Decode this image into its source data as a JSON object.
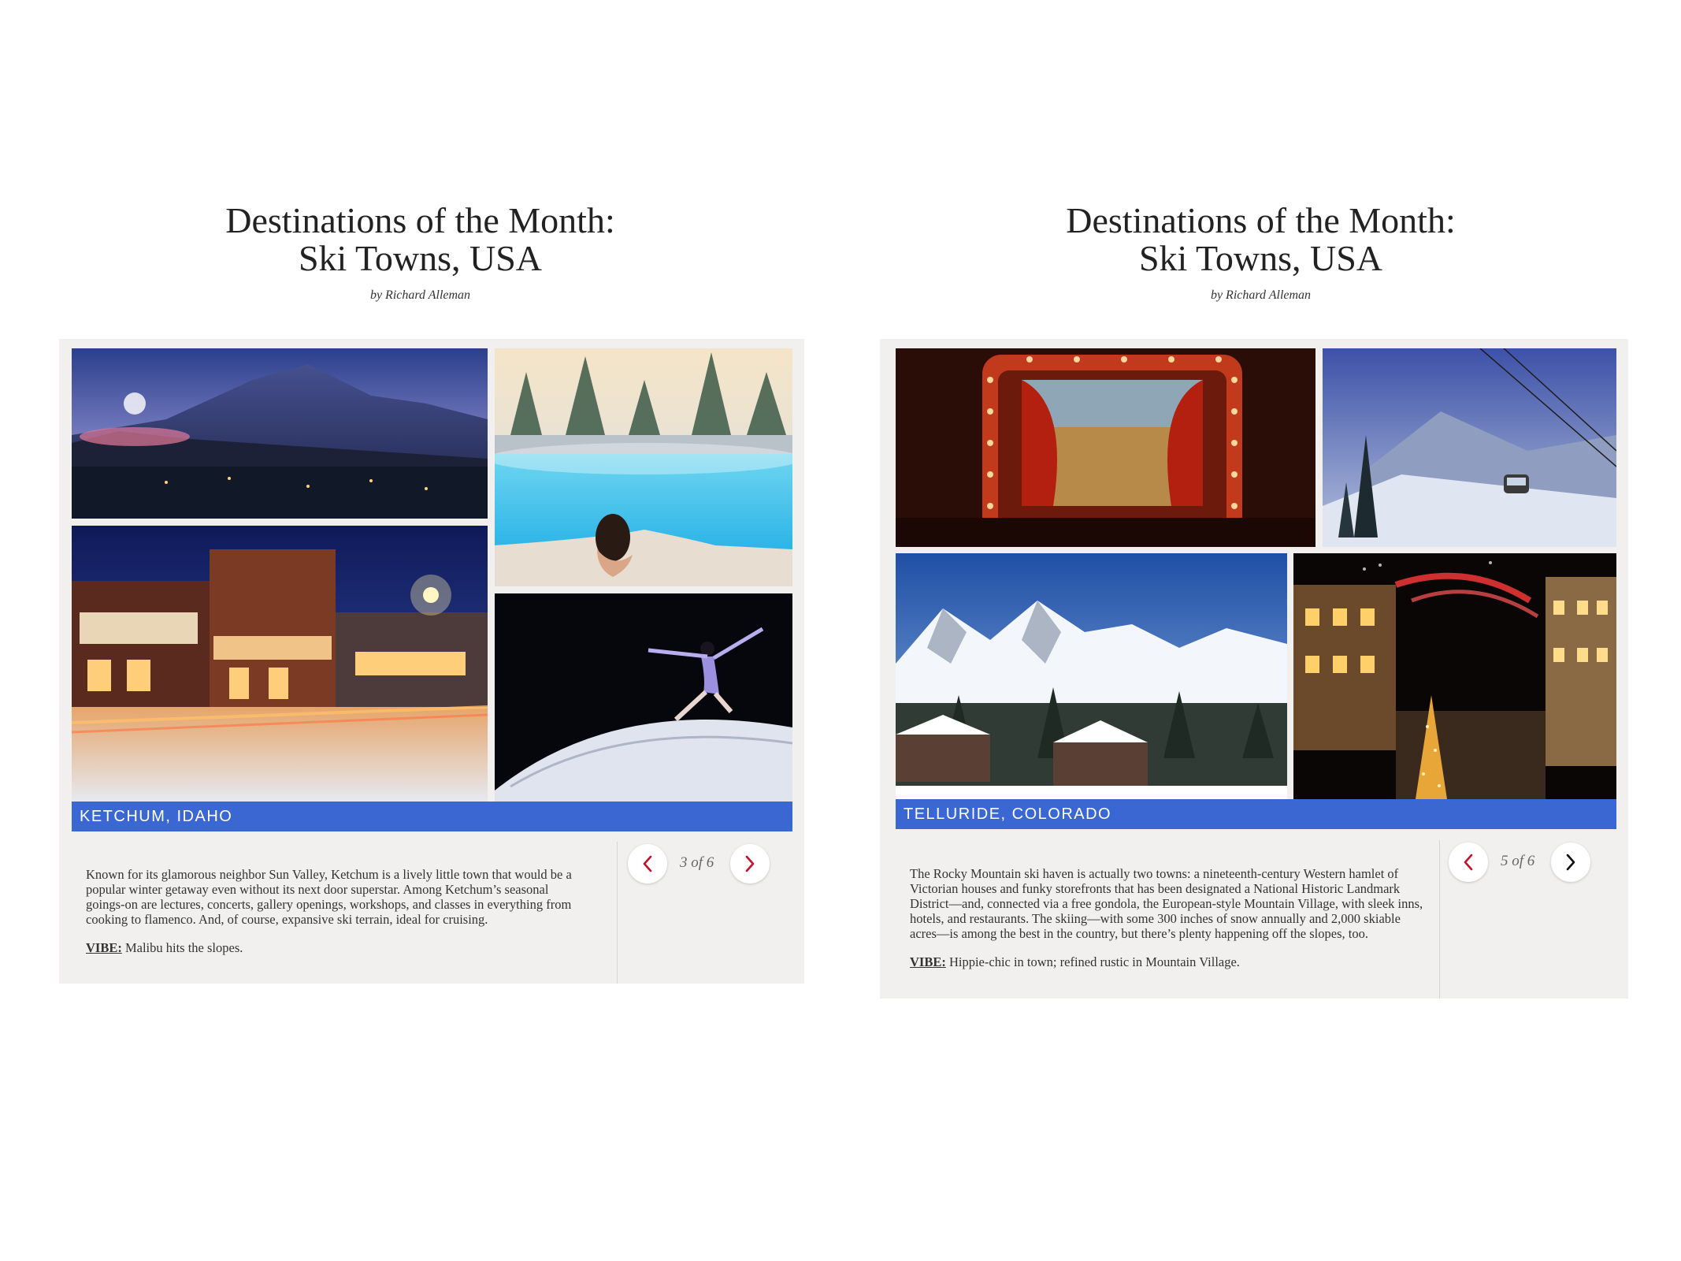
{
  "slides": [
    {
      "title_line1": "Destinations of the Month:",
      "title_line2": "Ski Towns, USA",
      "byline": "by Richard Alleman",
      "location": "KETCHUM, IDAHO",
      "description": "Known for its glamorous neighbor Sun Valley, Ketchum is a lively little town that would be a popular winter getaway even without its next door superstar. Among Ketchum’s seasonal goings-on are lectures, concerts, gallery openings, workshops, and classes in everything from cooking to flamenco. And, of course, expansive ski terrain, ideal for cruising.",
      "vibe_label": "VIBE:",
      "vibe_text": "Malibu hits the slopes.",
      "counter": "3 of 6",
      "prev_icon": "chevron-left-icon",
      "next_icon": "chevron-right-icon",
      "prev_color": "#c8102e",
      "next_color": "#c8102e"
    },
    {
      "title_line1": "Destinations of the Month:",
      "title_line2": "Ski Towns, USA",
      "byline": "by Richard Alleman",
      "location": "TELLURIDE, COLORADO",
      "description": "The Rocky Mountain ski haven is actually two towns: a nineteenth-century Western hamlet of Victorian houses and funky storefronts that has been designated a National Historic Landmark District—and, connected via a free gondola, the European-style Mountain Village, with sleek inns, hotels, and restaurants. The skiing—with some 300 inches of snow annually and 2,000 skiable acres—is among the best in the country, but there’s plenty happening off the slopes, too.",
      "vibe_label": "VIBE:",
      "vibe_text": "Hippie-chic in town; refined rustic in Mountain Village.",
      "counter": "5 of 6",
      "prev_icon": "chevron-left-icon",
      "next_icon": "chevron-right-icon",
      "prev_color": "#c8102e",
      "next_color": "#111111"
    }
  ],
  "colors": {
    "caption_bar": "#3a67d1",
    "card_bg": "#f1f0ee"
  }
}
